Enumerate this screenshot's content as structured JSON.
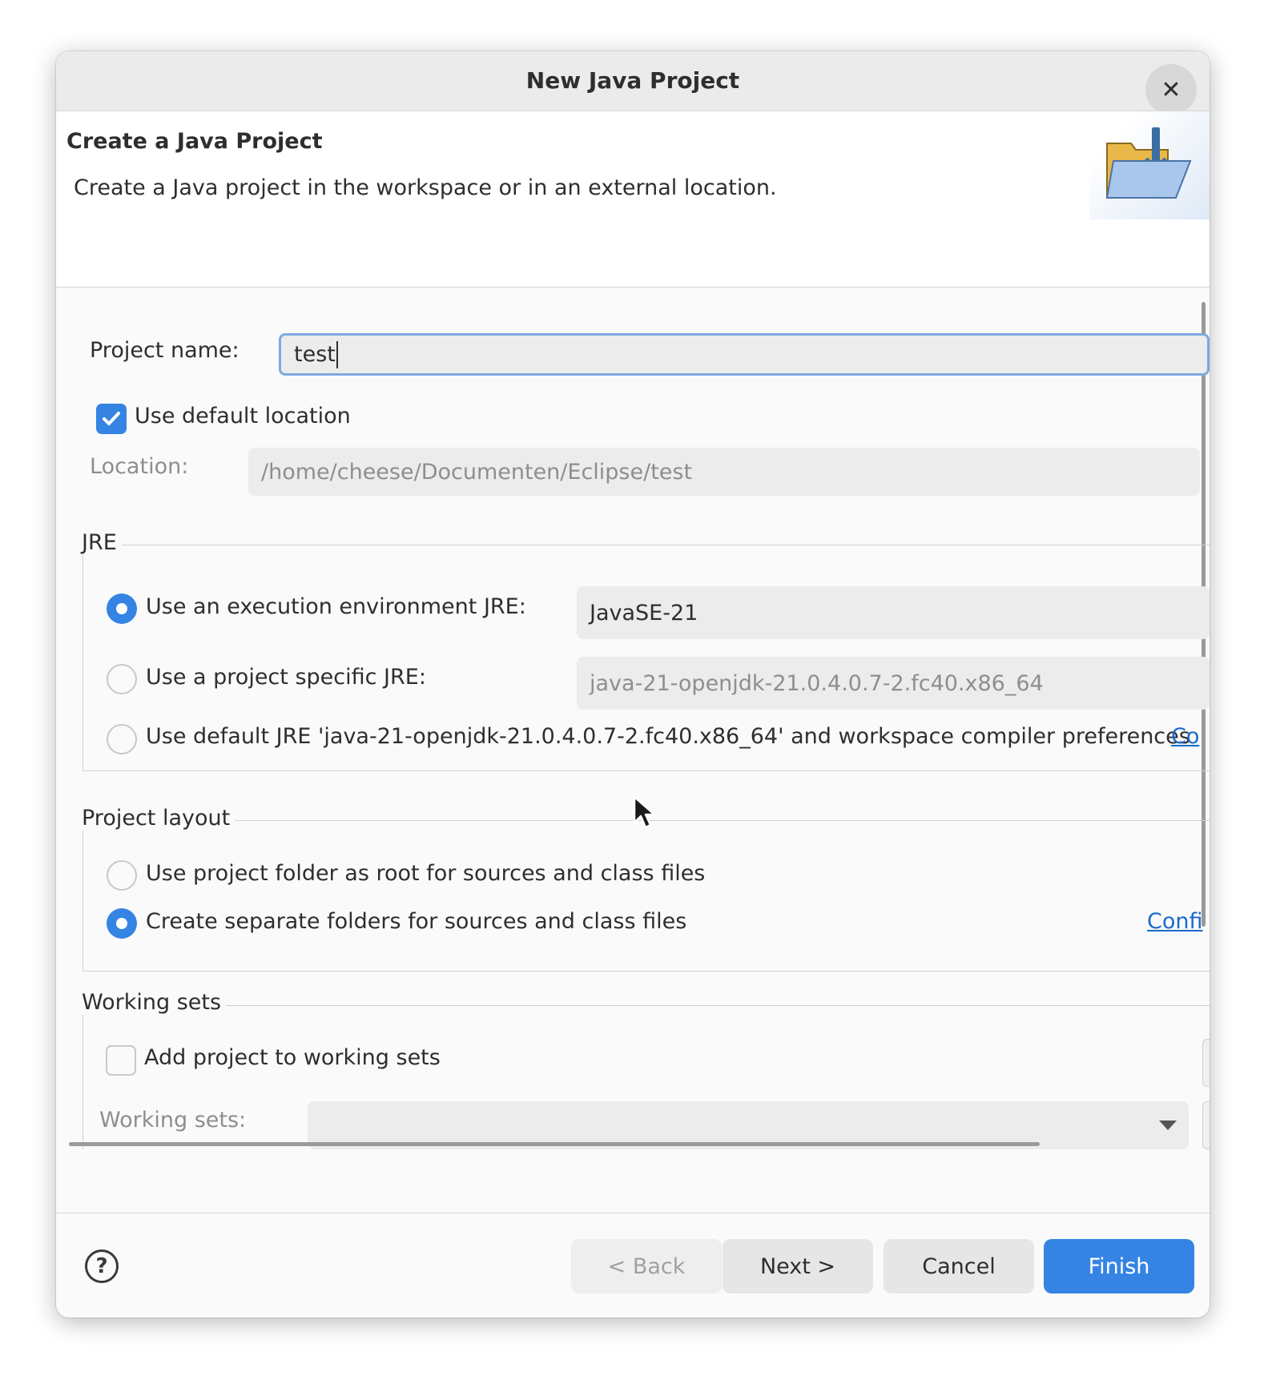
{
  "dialog": {
    "title": "New Java Project",
    "close_icon": "close-icon"
  },
  "header": {
    "title": "Create a Java Project",
    "description": "Create a Java project in the workspace or in an external location.",
    "banner_icon": "java-folder-icon"
  },
  "project": {
    "name_label": "Project name:",
    "name_value": "test",
    "use_default_location_label": "Use default location",
    "use_default_location_checked": true,
    "location_label": "Location:",
    "location_value": "/home/cheese/Documenten/Eclipse/test"
  },
  "jre": {
    "group_title": "JRE",
    "options": [
      {
        "label": "Use an execution environment JRE:",
        "selected": true,
        "value": "JavaSE-21"
      },
      {
        "label": "Use a project specific JRE:",
        "selected": false,
        "value": "java-21-openjdk-21.0.4.0.7-2.fc40.x86_64"
      },
      {
        "label": "Use default JRE 'java-21-openjdk-21.0.4.0.7-2.fc40.x86_64' and workspace compiler preferences",
        "selected": false
      }
    ],
    "configure_link": "Co"
  },
  "layout": {
    "group_title": "Project layout",
    "options": [
      {
        "label": "Use project folder as root for sources and class files",
        "selected": false
      },
      {
        "label": "Create separate folders for sources and class files",
        "selected": true
      }
    ],
    "configure_link": "Confi"
  },
  "working_sets": {
    "group_title": "Working sets",
    "add_label": "Add project to working sets",
    "add_checked": false,
    "sets_label": "Working sets:"
  },
  "footer": {
    "help_icon": "help-icon",
    "back": "< Back",
    "next": "Next >",
    "cancel": "Cancel",
    "finish": "Finish"
  },
  "colors": {
    "accent": "#3584e4",
    "link": "#1b6acb"
  }
}
